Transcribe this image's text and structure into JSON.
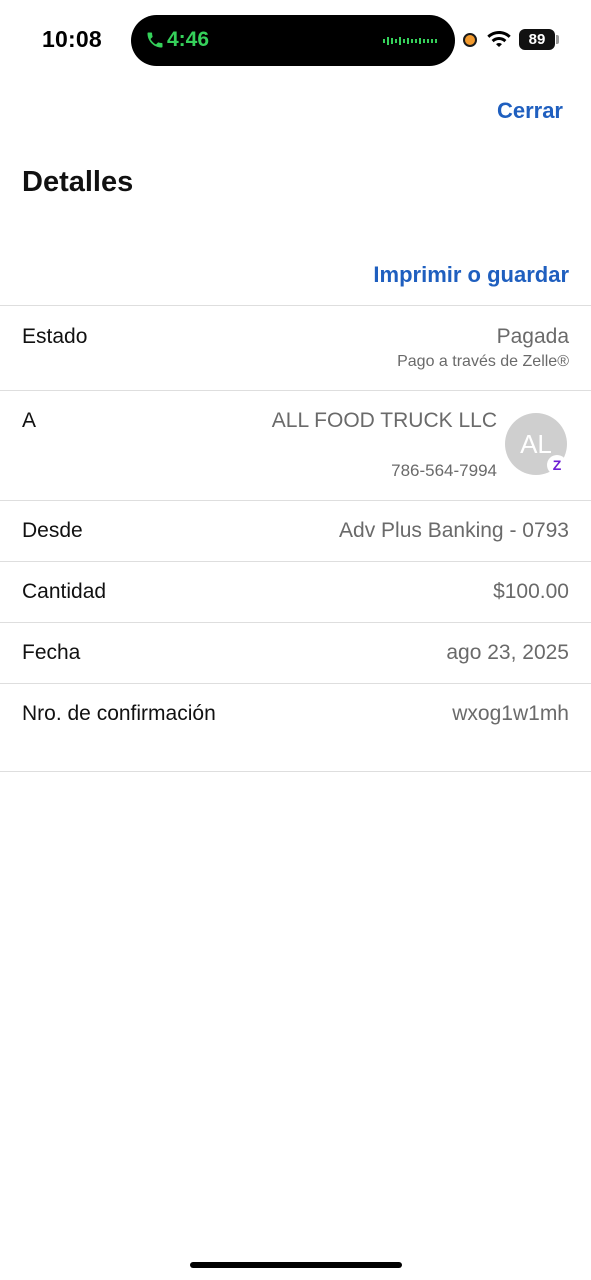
{
  "status_bar": {
    "time": "10:08",
    "call_timer": "4:46",
    "battery": "89",
    "call_color": "#35d05a",
    "recording_dot_color": "#f29a2e"
  },
  "header": {
    "close_label": "Cerrar",
    "title": "Detalles",
    "print_label": "Imprimir o guardar",
    "accent_color": "#1f5fbf"
  },
  "details": {
    "status": {
      "label": "Estado",
      "value": "Pagada",
      "note": "Pago a través de Zelle®"
    },
    "recipient": {
      "label": "A",
      "name": "ALL FOOD TRUCK LLC",
      "phone": "786-564-7994",
      "avatar_initials": "AL",
      "badge_glyph": "Z",
      "badge_icon": "zelle-icon"
    },
    "from": {
      "label": "Desde",
      "value": "Adv Plus Banking - 0793"
    },
    "amount": {
      "label": "Cantidad",
      "value": "$100.00"
    },
    "date": {
      "label": "Fecha",
      "value": "ago 23, 2025"
    },
    "confirmation": {
      "label": "Nro. de confirmación",
      "value": "wxog1w1mh"
    }
  }
}
